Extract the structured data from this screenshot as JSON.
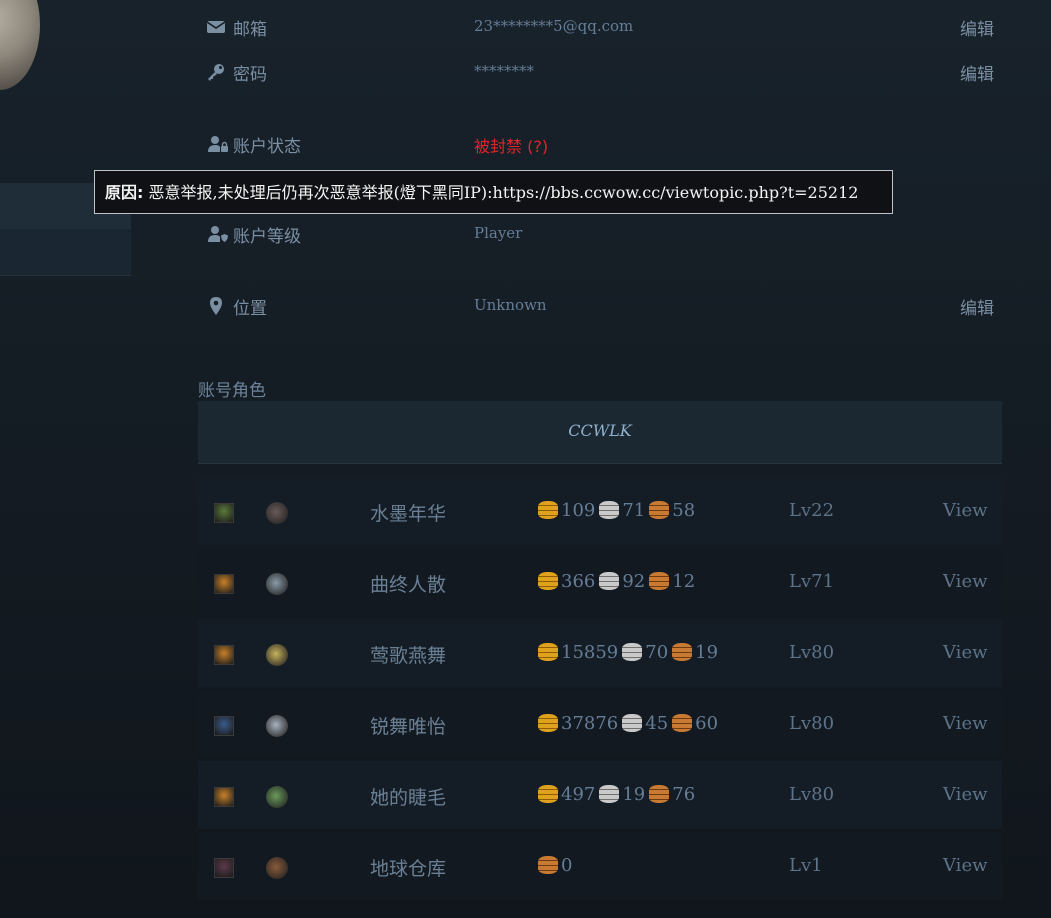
{
  "profile": {
    "email": {
      "label": "邮箱",
      "value": "23********5@qq.com",
      "edit": "编辑"
    },
    "password": {
      "label": "密码",
      "value": "********",
      "edit": "编辑"
    },
    "status": {
      "label": "账户状态",
      "value": "被封禁 (?)"
    },
    "tooltip": {
      "prefix": "原因:",
      "text": "恶意举报,未处理后仍再次恶意举报(燈下黑同IP):https://bbs.ccwow.cc/viewtopic.php?t=25212"
    },
    "level": {
      "label": "账户等级",
      "value": "Player"
    },
    "location": {
      "label": "位置",
      "value": "Unknown",
      "edit": "编辑"
    }
  },
  "characters_section": {
    "title": "账号角色",
    "realm": "CCWLK",
    "rows": [
      {
        "name": "水墨年华",
        "gold": "109",
        "silver": "71",
        "copper": "58",
        "level": "Lv22",
        "view": "View",
        "race_color": "#5b7a3a",
        "class_color": "#6a5a5a"
      },
      {
        "name": "曲终人散",
        "gold": "366",
        "silver": "92",
        "copper": "12",
        "level": "Lv71",
        "view": "View",
        "race_color": "#c8802a",
        "class_color": "#8a9aa8"
      },
      {
        "name": "莺歌燕舞",
        "gold": "15859",
        "silver": "70",
        "copper": "19",
        "level": "Lv80",
        "view": "View",
        "race_color": "#c8802a",
        "class_color": "#c8b25a"
      },
      {
        "name": "锐舞唯怡",
        "gold": "37876",
        "silver": "45",
        "copper": "60",
        "level": "Lv80",
        "view": "View",
        "race_color": "#3a5a8a",
        "class_color": "#a8b2c0"
      },
      {
        "name": "她的睫毛",
        "gold": "497",
        "silver": "19",
        "copper": "76",
        "level": "Lv80",
        "view": "View",
        "race_color": "#c8802a",
        "class_color": "#6a9a5a"
      },
      {
        "name": "地球仓库",
        "gold": "",
        "silver": "",
        "copper": "0",
        "level": "Lv1",
        "view": "View",
        "race_color": "#5b3a4a",
        "class_color": "#8a5a3a"
      }
    ]
  },
  "colors": {
    "banned": "#e0252a",
    "tooltip_bg": "#0f1114",
    "accent": "#8fb0cf"
  }
}
